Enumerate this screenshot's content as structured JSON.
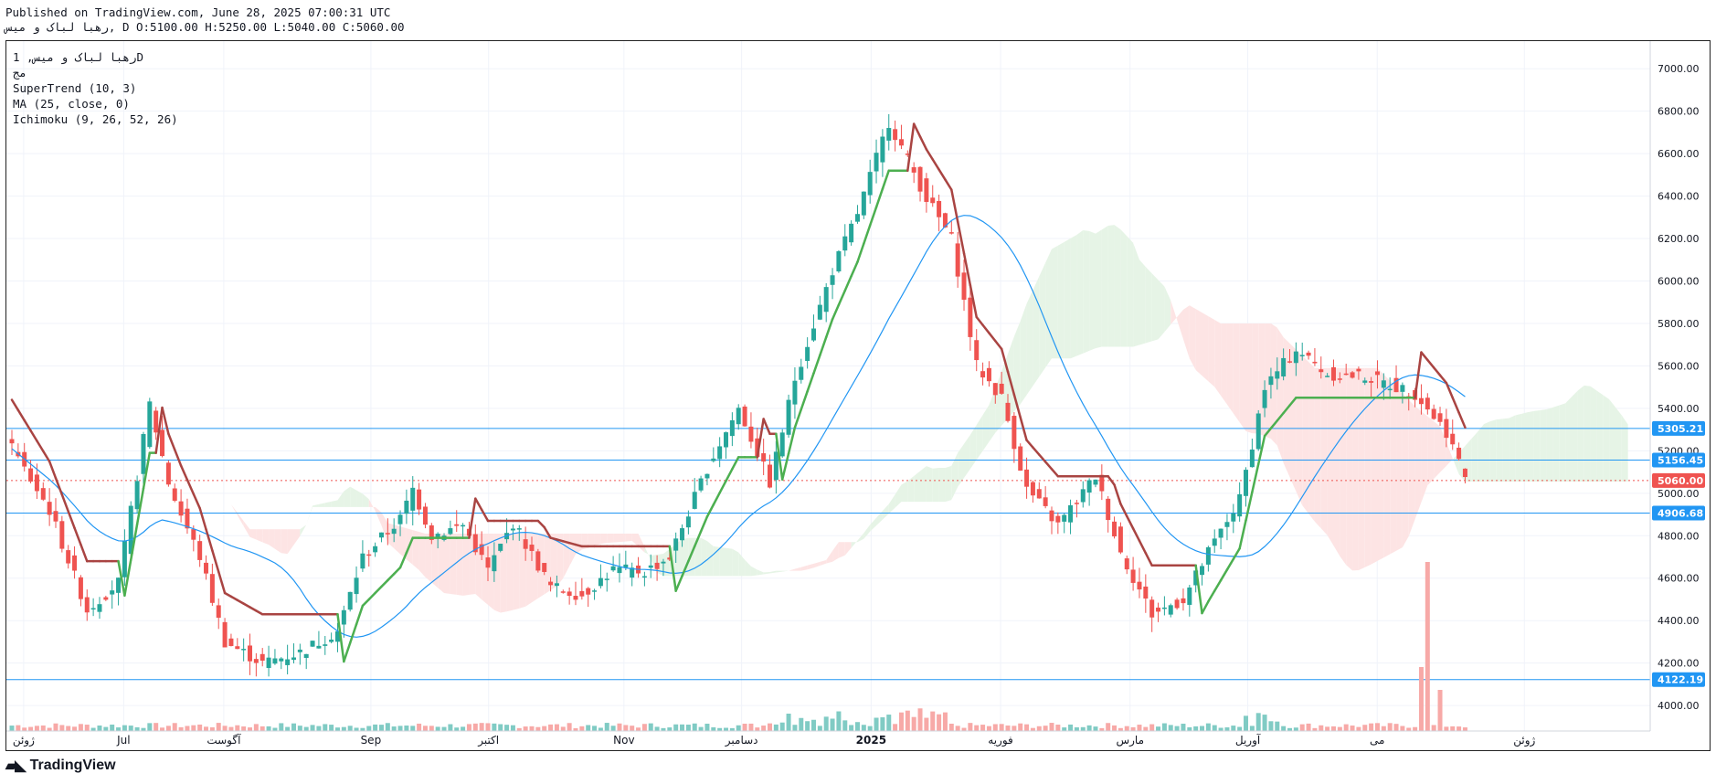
{
  "header": {
    "line1": "Published on TradingView.com, June 28, 2025 07:00:31 UTC",
    "line2": "رهبا لباک و میس, D O:5100.00 H:5250.00 L:5040.00 C:5060.00"
  },
  "legend": {
    "symbol_line": "رهبا لباک و میس, 1D",
    "exchange": "مج",
    "indicator1": "SuperTrend (10, 3)",
    "indicator2": "MA (25, close, 0)",
    "indicator3": "Ichimoku (9, 26, 52, 26)"
  },
  "footer": {
    "brand": "TradingView"
  },
  "colors": {
    "up": "#26a69a",
    "down": "#ef5350",
    "supertrend_down": "#a94442",
    "supertrend_up": "#4caf50",
    "ma": "#2196f3",
    "hline": "#2196f3",
    "cloud_bull": "#e6f4e6",
    "cloud_bear": "#fde4e4"
  },
  "chart_data": {
    "type": "candlestick",
    "y_ticks": [
      4000,
      4200,
      4400,
      4600,
      4800,
      5000,
      5200,
      5400,
      5600,
      5800,
      6000,
      6200,
      6400,
      6600,
      6800,
      7000
    ],
    "y_tick_labels": [
      "4000.00",
      "4200.00",
      "4400.00",
      "4600.00",
      "4800.00",
      "5000.00",
      "5200.00",
      "5400.00",
      "5600.00",
      "5800.00",
      "6000.00",
      "6200.00",
      "6400.00",
      "6600.00",
      "6800.00",
      "7000.00"
    ],
    "ylim": [
      3880,
      7130
    ],
    "x_labels": [
      "ژوئن",
      "Jul",
      "آگوست",
      "Sep",
      "اکتبر",
      "Nov",
      "دسامبر",
      "2025",
      "فوریه",
      "مارس",
      "آوریل",
      "می",
      "ژوئن"
    ],
    "x_label_index": [
      2,
      19,
      36,
      61,
      81,
      104,
      124,
      146,
      168,
      190,
      210,
      232,
      257
    ],
    "horizontal_levels": [
      {
        "value": 5305.21,
        "label": "5305.21"
      },
      {
        "value": 5156.45,
        "label": "5156.45"
      },
      {
        "value": 4906.68,
        "label": "4906.68"
      },
      {
        "value": 4122.19,
        "label": "4122.19"
      }
    ],
    "last_price": {
      "value": 5060.0,
      "label": "5060.00"
    },
    "ohlc": {
      "open": 5100.0,
      "high": 5250.0,
      "low": 5040.0,
      "close": 5060.0
    }
  }
}
